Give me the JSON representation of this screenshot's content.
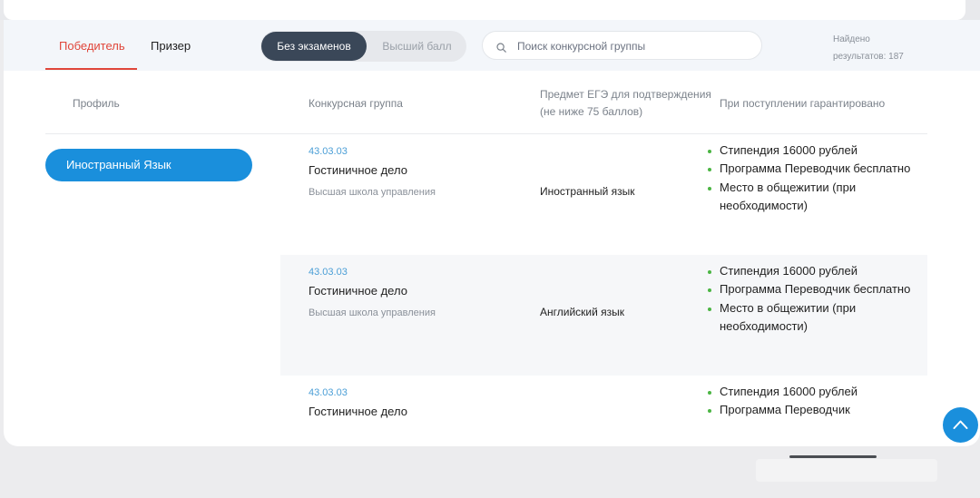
{
  "tabs": {
    "winner": "Победитель",
    "prize": "Призер"
  },
  "toggle": {
    "active": "Без экзаменов",
    "inactive": "Высший балл"
  },
  "search": {
    "placeholder": "Поиск конкурсной группы"
  },
  "results": {
    "line1": "Найдено",
    "line2": "результатов: 187"
  },
  "table": {
    "headers": {
      "profile": "Профиль",
      "group": "Конкурсная группа",
      "subject_line1": "Предмет ЕГЭ для подтверждения",
      "subject_line2": "(не ниже 75 баллов)",
      "guarantee": "При поступлении гарантировано"
    },
    "profile_label": "Иностранный Язык",
    "rows": [
      {
        "code": "43.03.03",
        "name": "Гостиничное дело",
        "school": "Высшая школа управления",
        "subject": "Иностранный язык",
        "guarantees": [
          "Стипендия 16000 рублей",
          "Программа Переводчик бесплатно",
          "Место в общежитии (при необходимости)"
        ]
      },
      {
        "code": "43.03.03",
        "name": "Гостиничное дело",
        "school": "Высшая школа управления",
        "subject": "Английский язык",
        "guarantees": [
          "Стипендия 16000 рублей",
          "Программа Переводчик бесплатно",
          "Место в общежитии (при необходимости)"
        ]
      },
      {
        "code": "43.03.03",
        "name": "Гостиничное дело",
        "school": "",
        "subject": "",
        "guarantees": [
          "Стипендия 16000 рублей",
          "Программа Переводчик"
        ]
      }
    ]
  },
  "icons": {
    "search": "search-icon",
    "scroll_top": "arrow-up-icon"
  },
  "colors": {
    "accent": "#1a8fdc",
    "active_tab": "#e0463a",
    "toggle_active": "#3a4758",
    "bullet": "#4bb543",
    "code_link": "#4a9ed6"
  }
}
